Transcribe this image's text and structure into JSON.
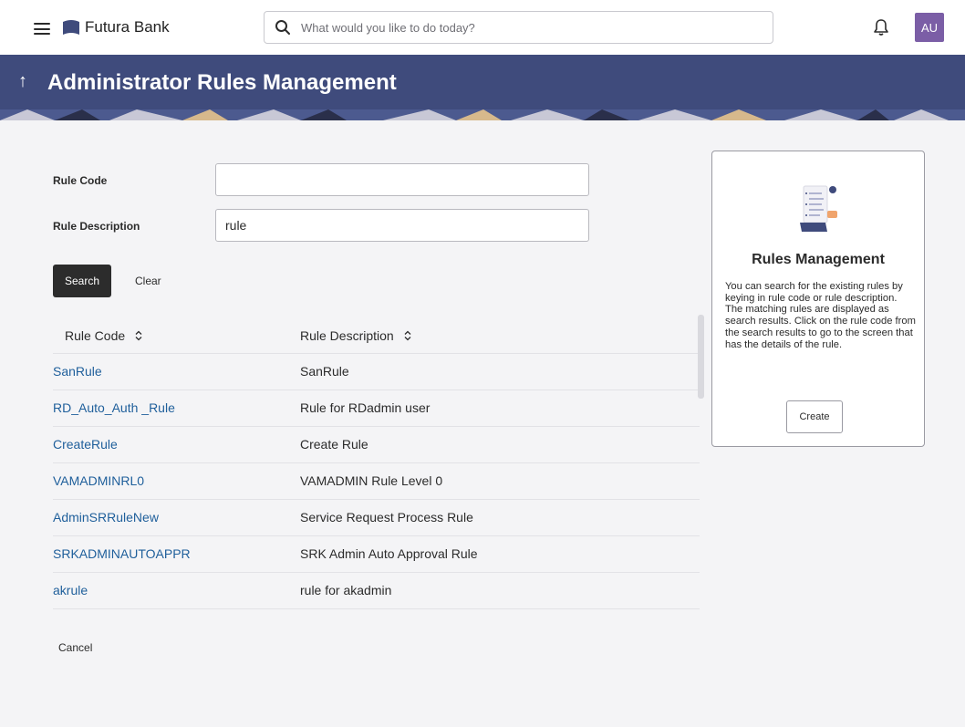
{
  "header": {
    "brand": "Futura Bank",
    "search_placeholder": "What would you like to do today?",
    "avatar_initials": "AU"
  },
  "banner": {
    "title": "Administrator Rules Management",
    "back_glyph": "↑"
  },
  "form": {
    "rule_code_label": "Rule Code",
    "rule_code_value": "",
    "rule_description_label": "Rule Description",
    "rule_description_value": "rule",
    "search_label": "Search",
    "clear_label": "Clear"
  },
  "table": {
    "columns": [
      "Rule Code",
      "Rule Description"
    ],
    "rows": [
      {
        "code": "SanRule",
        "description": "SanRule"
      },
      {
        "code": "RD_Auto_Auth _Rule",
        "description": "Rule for RDadmin user"
      },
      {
        "code": "CreateRule",
        "description": "Create Rule"
      },
      {
        "code": "VAMADMINRL0",
        "description": "VAMADMIN Rule Level 0"
      },
      {
        "code": "AdminSRRuleNew",
        "description": "Service Request Process Rule"
      },
      {
        "code": "SRKADMINAUTOAPPR",
        "description": "SRK Admin Auto Approval Rule"
      },
      {
        "code": "akrule",
        "description": "rule for akadmin"
      }
    ]
  },
  "footer": {
    "cancel_label": "Cancel"
  },
  "info_card": {
    "title": "Rules Management",
    "text": "You can search for the existing rules by keying in rule code or rule description. The matching rules are displayed as search results. Click on the rule code from the search results to go to the screen that has the details of the rule.",
    "create_label": "Create"
  },
  "colors": {
    "banner": "#3f4b7c",
    "link": "#1f5f9b",
    "avatar": "#7b5ea6",
    "primary_button": "#2c2c2c"
  },
  "icons": [
    "hamburger-icon",
    "bank-logo-icon",
    "search-icon",
    "bell-icon",
    "back-arrow-icon",
    "sort-icon",
    "rules-illustration-icon"
  ]
}
